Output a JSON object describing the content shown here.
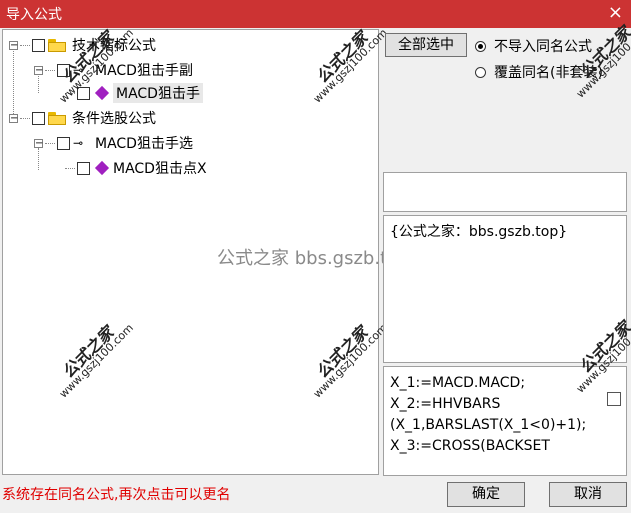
{
  "window": {
    "title": "导入公式",
    "close_icon": "×"
  },
  "tree": {
    "root1": {
      "label": "技术指标公式",
      "expander": "−"
    },
    "child1": {
      "label": "MACD狙击手副",
      "expander": "−"
    },
    "child1a": {
      "label": "MACD狙击手"
    },
    "root2": {
      "label": "条件选股公式",
      "expander": "−"
    },
    "child2": {
      "label": "MACD狙击手选",
      "expander": "−"
    },
    "child2a": {
      "label": "MACD狙击点X"
    }
  },
  "buttons": {
    "select_all": "全部选中",
    "ok": "确定",
    "cancel": "取消"
  },
  "options": [
    {
      "label": "不导入同名公式",
      "selected": true
    },
    {
      "label": "覆盖同名(非套装)",
      "selected": false
    }
  ],
  "info": {
    "description": "{公式之家：bbs.gszb.top}"
  },
  "code": {
    "lines": [
      "X_1:=MACD.MACD;",
      "X_2:=HHVBARS",
      "(X_1,BARSLAST(X_1<0)+1);",
      "X_3:=CROSS(BACKSET"
    ]
  },
  "status": {
    "message": "系统存在同名公式,再次点击可以更名"
  },
  "watermark": {
    "center": "公式之家 bbs.gszb.top",
    "stamp_big": "公式之家",
    "stamp_small": "www.gszj100.com"
  },
  "colors": {
    "titlebar": "#cc3333",
    "status": "#e00000"
  }
}
